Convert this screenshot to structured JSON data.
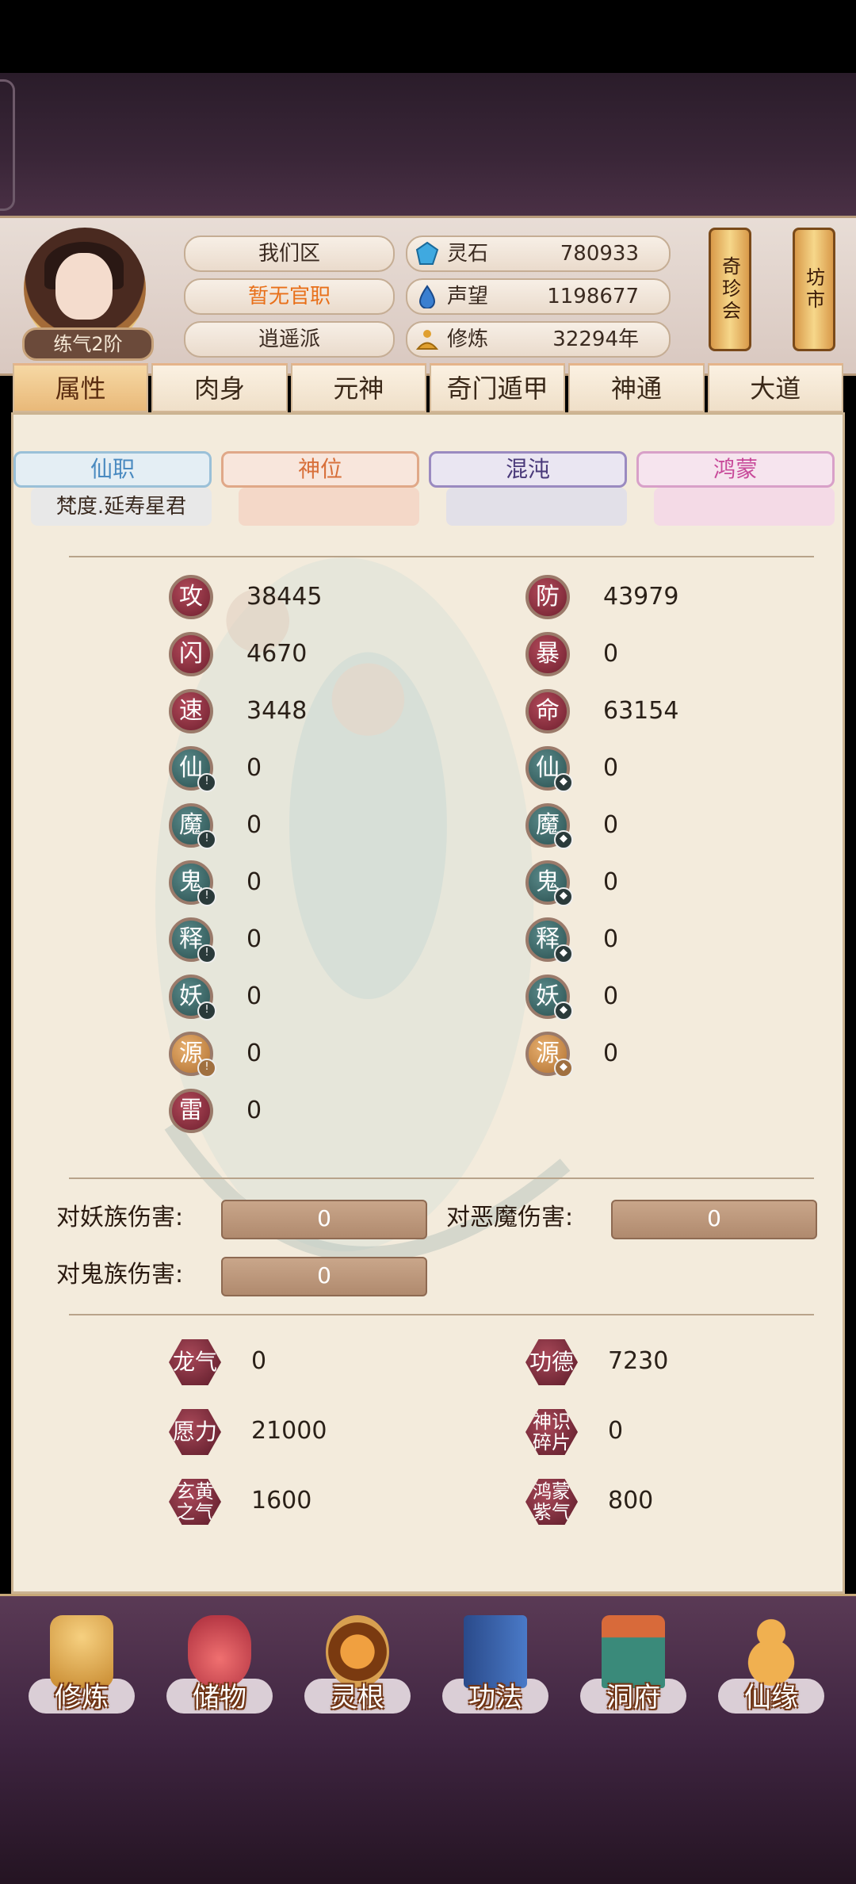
{
  "header": {
    "level": "练气2阶",
    "server": "我们区",
    "official_post": "暂无官职",
    "sect": "逍遥派",
    "resources": [
      {
        "name": "灵石",
        "value": "780933",
        "icon": "crystal-icon",
        "color": "#3fa9e0"
      },
      {
        "name": "声望",
        "value": "1198677",
        "icon": "drop-icon",
        "color": "#3a7fd0"
      },
      {
        "name": "修炼",
        "value": "32294年",
        "icon": "meditation-icon",
        "color": "#e0a030"
      }
    ],
    "shortcuts": [
      {
        "label": "奇珍会"
      },
      {
        "label": "坊市"
      }
    ]
  },
  "tabs": [
    {
      "label": "属性",
      "active": true
    },
    {
      "label": "肉身"
    },
    {
      "label": "元神"
    },
    {
      "label": "奇门遁甲"
    },
    {
      "label": "神通"
    },
    {
      "label": "大道"
    }
  ],
  "ranks": [
    {
      "label": "仙职",
      "value": "梵度.延寿星君",
      "color": "#6aa8d8"
    },
    {
      "label": "神位",
      "value": "",
      "color": "#e08a5a"
    },
    {
      "label": "混沌",
      "value": "",
      "color": "#6a5a9a"
    },
    {
      "label": "鸿蒙",
      "value": "",
      "color": "#c85aa8"
    }
  ],
  "stats_left": [
    {
      "icon": "攻",
      "value": "38445",
      "style": "red"
    },
    {
      "icon": "闪",
      "value": "4670",
      "style": "red"
    },
    {
      "icon": "速",
      "value": "3448",
      "style": "red"
    },
    {
      "icon": "仙",
      "value": "0",
      "style": "teal",
      "badge": "!"
    },
    {
      "icon": "魔",
      "value": "0",
      "style": "teal",
      "badge": "!"
    },
    {
      "icon": "鬼",
      "value": "0",
      "style": "teal",
      "badge": "!"
    },
    {
      "icon": "释",
      "value": "0",
      "style": "teal",
      "badge": "!"
    },
    {
      "icon": "妖",
      "value": "0",
      "style": "teal",
      "badge": "!"
    },
    {
      "icon": "源",
      "value": "0",
      "style": "gold",
      "badge": "!"
    },
    {
      "icon": "雷",
      "value": "0",
      "style": "red"
    }
  ],
  "stats_right": [
    {
      "icon": "防",
      "value": "43979",
      "style": "red"
    },
    {
      "icon": "暴",
      "value": "0",
      "style": "red"
    },
    {
      "icon": "命",
      "value": "63154",
      "style": "red"
    },
    {
      "icon": "仙",
      "value": "0",
      "style": "teal",
      "badge": "◆"
    },
    {
      "icon": "魔",
      "value": "0",
      "style": "teal",
      "badge": "◆"
    },
    {
      "icon": "鬼",
      "value": "0",
      "style": "teal",
      "badge": "◆"
    },
    {
      "icon": "释",
      "value": "0",
      "style": "teal",
      "badge": "◆"
    },
    {
      "icon": "妖",
      "value": "0",
      "style": "teal",
      "badge": "◆"
    },
    {
      "icon": "源",
      "value": "0",
      "style": "gold",
      "badge": "◆"
    }
  ],
  "damage": [
    {
      "label": "对妖族伤害:",
      "value": "0"
    },
    {
      "label": "对恶魔伤害:",
      "value": "0"
    },
    {
      "label": "对鬼族伤害:",
      "value": "0"
    }
  ],
  "misc": [
    {
      "label": "龙气",
      "value": "0"
    },
    {
      "label": "功德",
      "value": "7230"
    },
    {
      "label": "愿力",
      "value": "21000"
    },
    {
      "label": "神识\n碎片",
      "value": "0"
    },
    {
      "label": "玄黄\n之气",
      "value": "1600"
    },
    {
      "label": "鸿蒙\n紫气",
      "value": "800"
    }
  ],
  "bottom_nav": [
    {
      "label": "修炼",
      "icon": "cultivate-icon",
      "color": "#e0a040"
    },
    {
      "label": "储物",
      "icon": "bag-icon",
      "color": "#d84a4a"
    },
    {
      "label": "灵根",
      "icon": "spirit-root-icon",
      "color": "#c87a2a"
    },
    {
      "label": "功法",
      "icon": "book-icon",
      "color": "#3a6ab8"
    },
    {
      "label": "洞府",
      "icon": "cave-icon",
      "color": "#3a9a8a"
    },
    {
      "label": "仙缘",
      "icon": "gourd-icon",
      "color": "#e0a040"
    }
  ]
}
